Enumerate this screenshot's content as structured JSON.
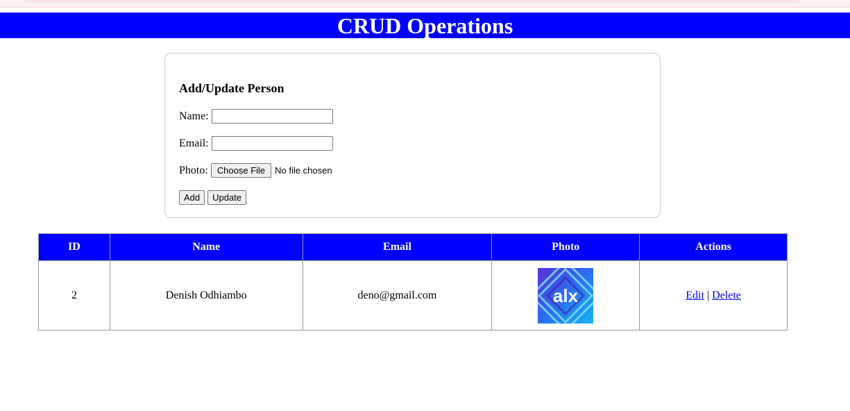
{
  "header": {
    "title": "CRUD Operations"
  },
  "form": {
    "title": "Add/Update Person",
    "name_label": "Name:",
    "name_value": "",
    "email_label": "Email:",
    "email_value": "",
    "photo_label": "Photo:",
    "choose_file_label": "Choose File",
    "file_status": "No file chosen",
    "add_label": "Add",
    "update_label": "Update"
  },
  "table": {
    "headers": [
      "ID",
      "Name",
      "Email",
      "Photo",
      "Actions"
    ],
    "rows": [
      {
        "id": "2",
        "name": "Denish Odhiambo",
        "email": "deno@gmail.com",
        "photo_logo": "alx",
        "edit_label": "Edit",
        "separator": "|",
        "delete_label": "Delete"
      }
    ]
  },
  "colors": {
    "header_bg": "#0000ff",
    "table_header_bg": "#0000ff",
    "link": "#0000ee"
  }
}
